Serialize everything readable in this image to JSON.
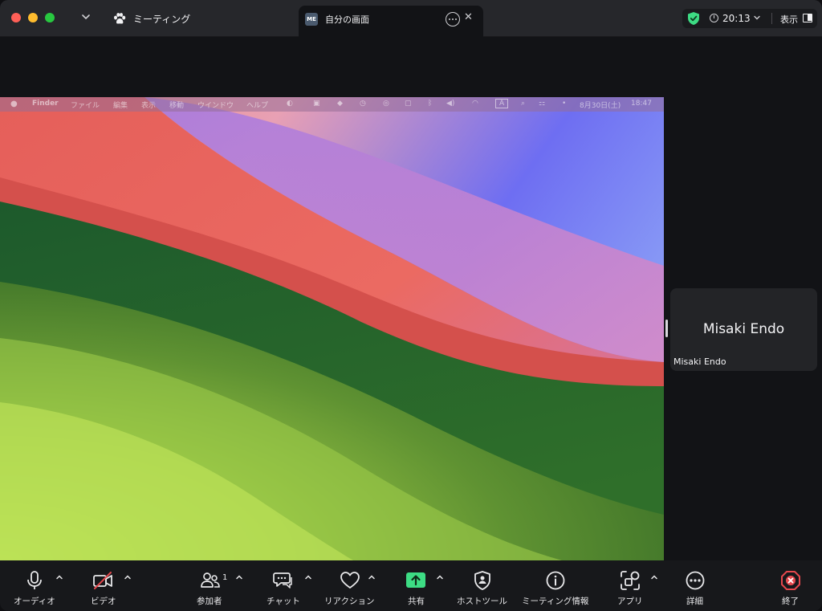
{
  "titlebar": {
    "meeting_tab_label": "ミーティング",
    "self_tab_avatar": "ME",
    "self_tab_label": "自分の画面",
    "time": "20:13",
    "view_label": "表示"
  },
  "shared_screen": {
    "menubar": {
      "app": "Finder",
      "menus": [
        "ファイル",
        "編集",
        "表示",
        "移動",
        "ウインドウ",
        "ヘルプ"
      ],
      "input_indicator": "A",
      "date": "8月30日(土)",
      "time": "18:47"
    }
  },
  "participant_tile": {
    "display_name": "Misaki Endo",
    "name_label": "Misaki Endo"
  },
  "toolbar": {
    "audio": "オーディオ",
    "video": "ビデオ",
    "participants": "参加者",
    "participants_count": "1",
    "chat": "チャット",
    "reactions": "リアクション",
    "share": "共有",
    "host_tools": "ホストツール",
    "meeting_info": "ミーティング情報",
    "apps": "アプリ",
    "more": "詳細",
    "end": "終了"
  },
  "colors": {
    "share_green": "#3ddc84",
    "end_red": "#e5484d",
    "shield_green": "#3ddc84"
  }
}
